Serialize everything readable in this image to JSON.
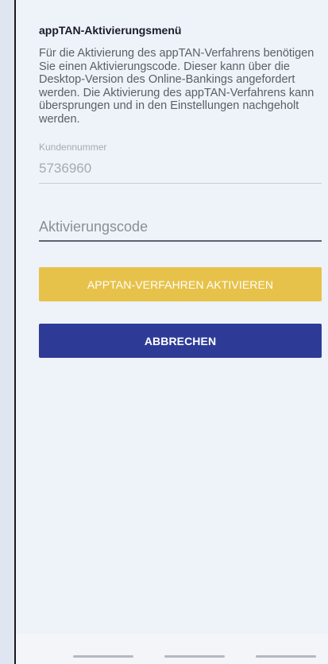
{
  "menu": {
    "title": "appTAN-Aktivierungsmenü",
    "description": "Für die Aktivierung des appTAN-Verfahrens benötigen Sie einen Aktivierungscode. Dieser kann über die Desktop-Version des Online-Bankings angefordert werden. Die Aktivierung des appTAN-Verfahrens kann übersprungen und in den Einstellungen nachgeholt werden."
  },
  "customer_number": {
    "label": "Kundennummer",
    "value": "5736960"
  },
  "activation_code": {
    "placeholder": "Aktivierungscode",
    "value": ""
  },
  "buttons": {
    "activate_label": "APPTAN-VERFAHREN AKTIVIEREN",
    "cancel_label": "ABBRECHEN"
  },
  "colors": {
    "activate_button": "#e7c24a",
    "cancel_button": "#2e3b96",
    "background": "#eef2f9"
  }
}
